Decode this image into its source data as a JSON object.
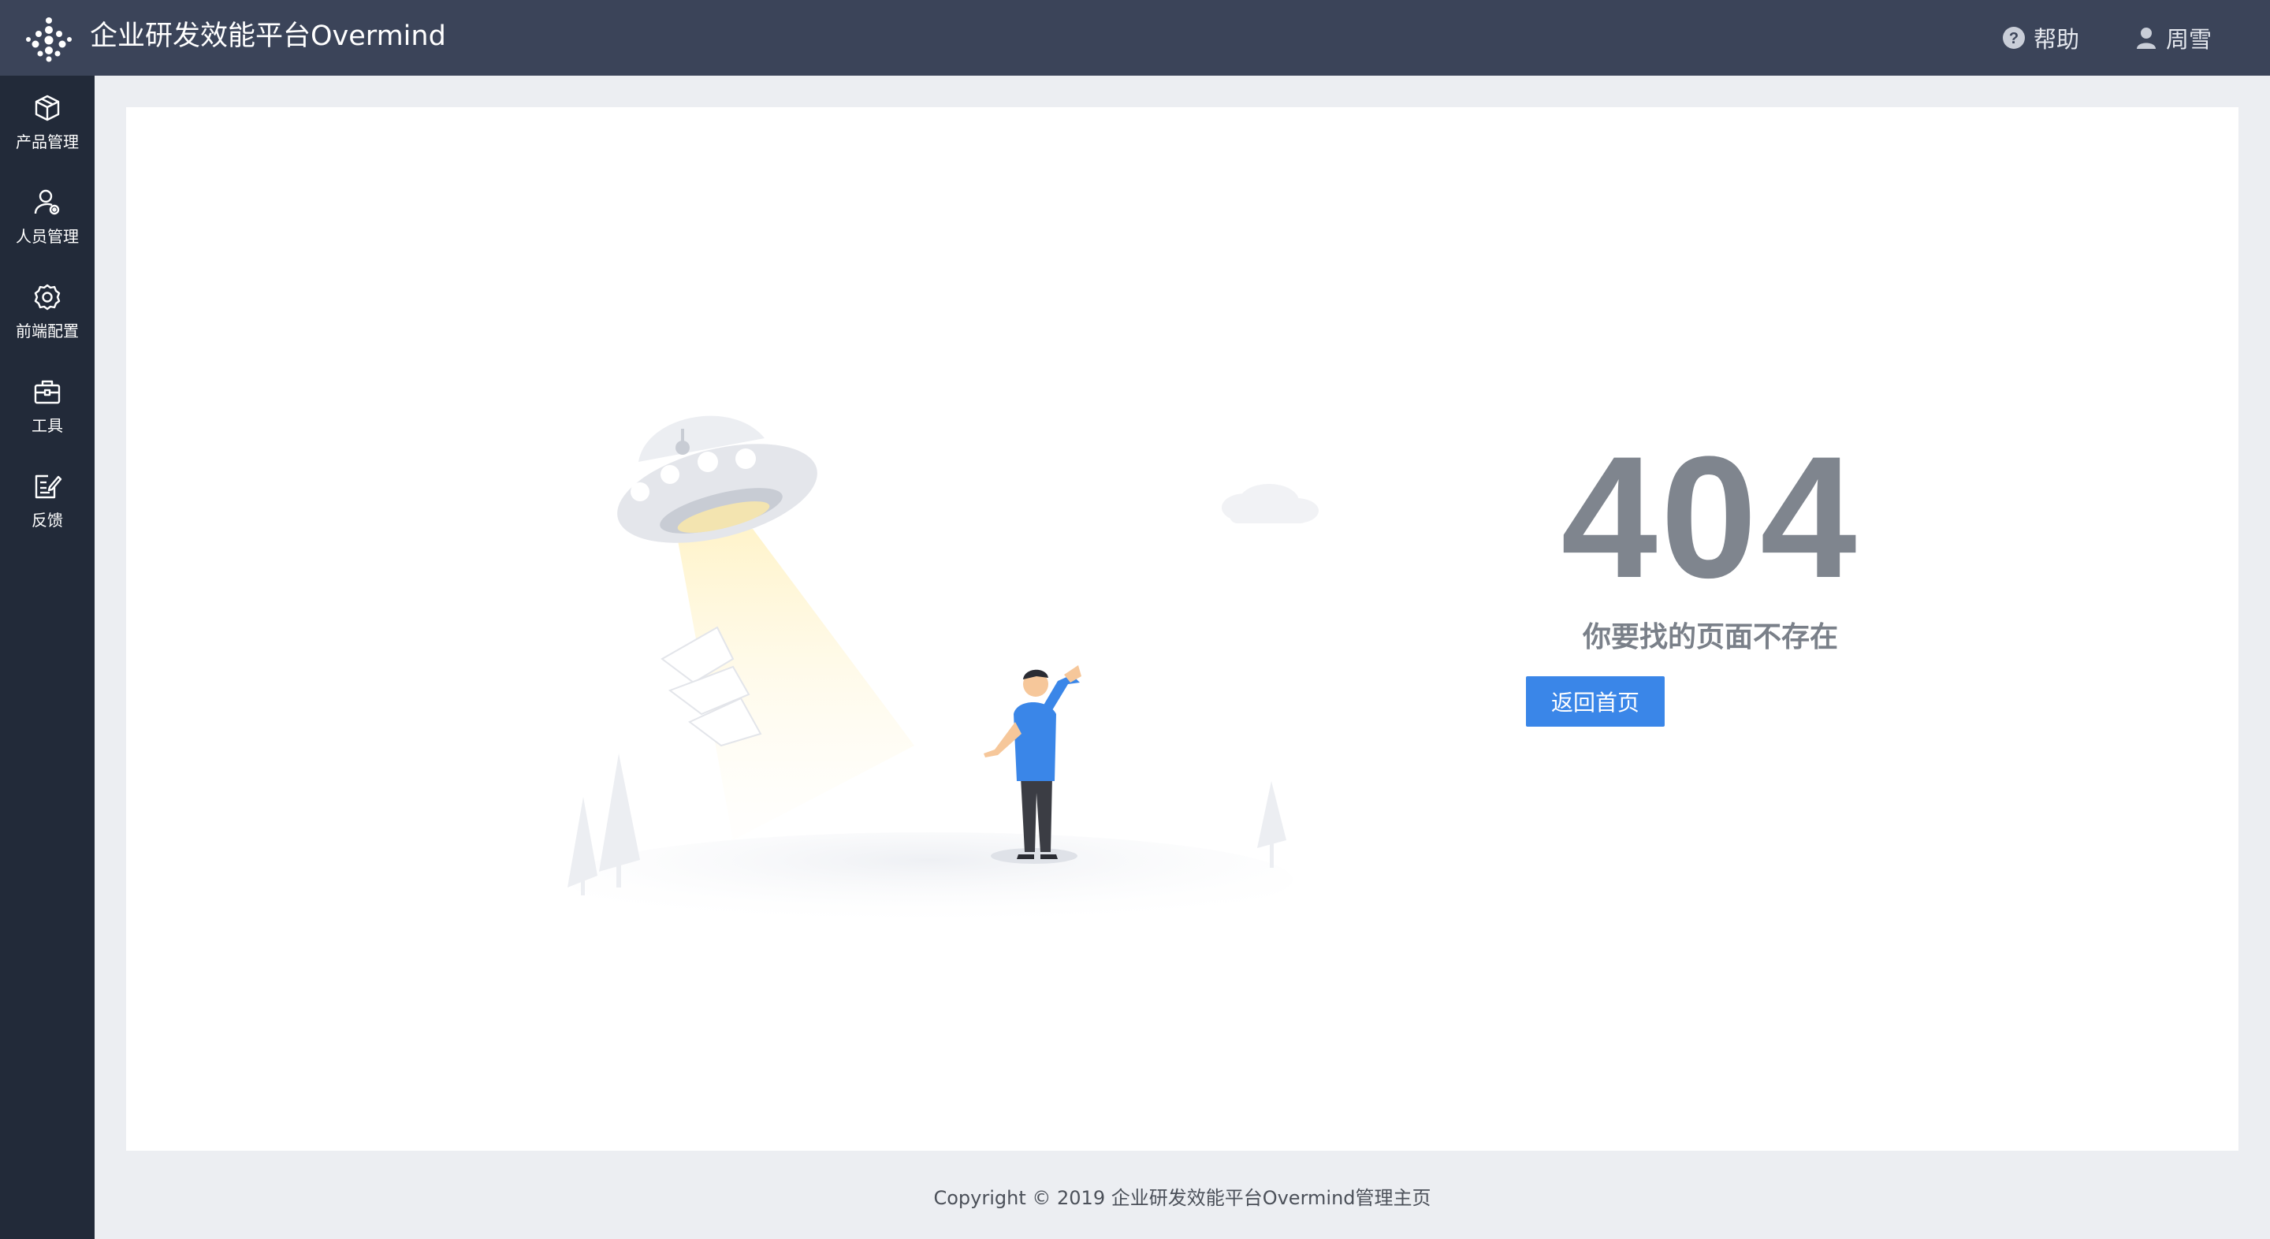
{
  "header": {
    "title": "企业研发效能平台Overmind",
    "help_label": "帮助",
    "user_name": "周雪"
  },
  "sidebar": {
    "items": [
      {
        "label": "产品管理",
        "icon": "cube-icon"
      },
      {
        "label": "人员管理",
        "icon": "user-settings-icon"
      },
      {
        "label": "前端配置",
        "icon": "gear-icon"
      },
      {
        "label": "工具",
        "icon": "toolbox-icon"
      },
      {
        "label": "反馈",
        "icon": "edit-icon"
      }
    ]
  },
  "error": {
    "code": "404",
    "message": "你要找的页面不存在",
    "home_button": "返回首页"
  },
  "footer": {
    "copyright": "Copyright © 2019 企业研发效能平台Overmind管理主页"
  },
  "colors": {
    "header_bg": "#3b4459",
    "sidebar_bg": "#222a39",
    "page_bg": "#eceef2",
    "accent": "#3a86e8",
    "error_text": "#7f858e"
  }
}
